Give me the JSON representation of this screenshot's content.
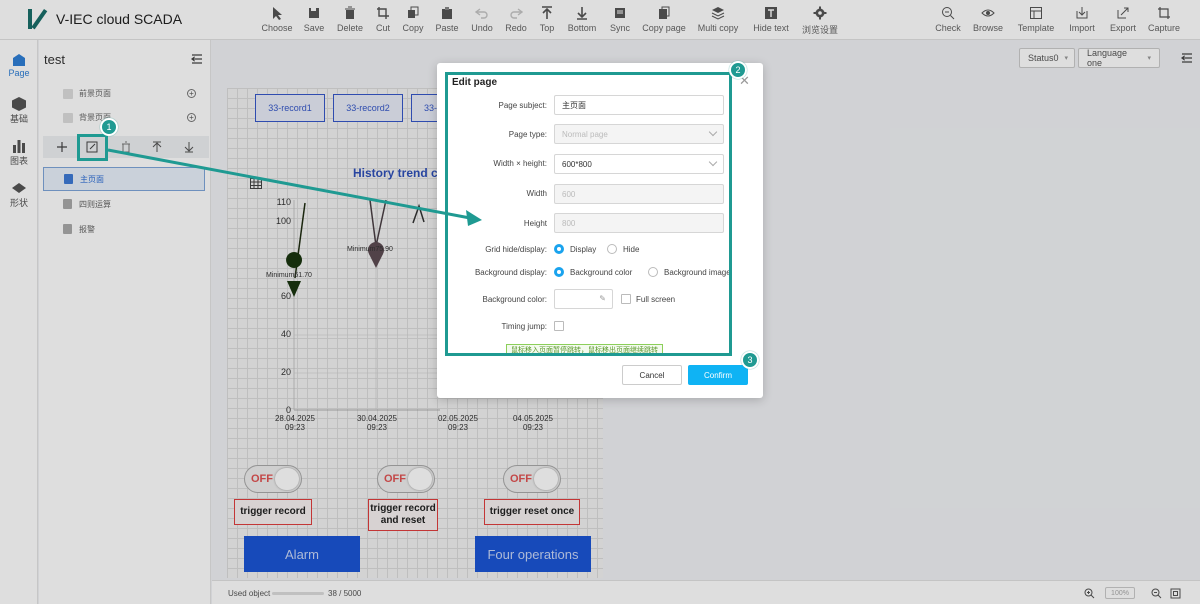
{
  "app": {
    "title": "V-IEC cloud SCADA"
  },
  "toolbar": [
    {
      "label": "Choose",
      "icon": "cursor-icon",
      "x": 253
    },
    {
      "label": "Save",
      "icon": "save-icon",
      "x": 290
    },
    {
      "label": "Delete",
      "icon": "trash-icon",
      "x": 326
    },
    {
      "label": "Cut",
      "icon": "crop-icon",
      "x": 359
    },
    {
      "label": "Copy",
      "icon": "copy-icon",
      "x": 389
    },
    {
      "label": "Paste",
      "icon": "paste-icon",
      "x": 423
    },
    {
      "label": "Undo",
      "icon": "undo-icon",
      "x": 458
    },
    {
      "label": "Redo",
      "icon": "redo-icon",
      "x": 492
    },
    {
      "label": "Top",
      "icon": "bring-top-icon",
      "x": 523
    },
    {
      "label": "Bottom",
      "icon": "send-bottom-icon",
      "x": 558
    },
    {
      "label": "Sync",
      "icon": "sync-icon",
      "x": 596
    },
    {
      "label": "Copy page",
      "icon": "copy-page-icon",
      "x": 640
    },
    {
      "label": "Multi copy",
      "icon": "layers-icon",
      "x": 694
    },
    {
      "label": "Hide text",
      "icon": "text-icon",
      "x": 747
    },
    {
      "label": "浏览设置",
      "icon": "gear-icon",
      "x": 796
    },
    {
      "label": "Check",
      "icon": "zoom-check-icon",
      "x": 924
    },
    {
      "label": "Browse",
      "icon": "eye-icon",
      "x": 964
    },
    {
      "label": "Template",
      "icon": "template-icon",
      "x": 1012
    },
    {
      "label": "Import",
      "icon": "import-icon",
      "x": 1058
    },
    {
      "label": "Export",
      "icon": "export-icon",
      "x": 1099
    },
    {
      "label": "Capture",
      "icon": "capture-icon",
      "x": 1140
    }
  ],
  "rail": [
    {
      "label": "Page",
      "active": true
    },
    {
      "label": "基础",
      "active": false
    },
    {
      "label": "图表",
      "active": false
    },
    {
      "label": "形状",
      "active": false
    }
  ],
  "panel": {
    "title": "test",
    "layers": [
      "前景页面",
      "背景页面"
    ],
    "pages": [
      "主页面",
      "四则运算",
      "报警"
    ]
  },
  "canvas": {
    "records": [
      "33-record1",
      "33-record2",
      "33-"
    ],
    "chart_title": "History trend c",
    "y_ticks": [
      "110",
      "100",
      "60",
      "40",
      "20",
      "0"
    ],
    "x_ticks": [
      [
        "28.04.2025",
        "09:23"
      ],
      [
        "30.04.2025",
        "09:23"
      ],
      [
        "02.05.2025",
        "09:23"
      ],
      [
        "04.05.2025",
        "09:23"
      ]
    ],
    "markers": [
      "Minimum61.70",
      "Minimum75.90"
    ],
    "toggle_text": "OFF",
    "triggers": [
      "trigger record",
      "trigger record and reset",
      "trigger reset once"
    ],
    "buttons": [
      "Alarm",
      "Four operations"
    ]
  },
  "selectors": {
    "status": "Status0",
    "language": "Language one"
  },
  "bottombar": {
    "used_label": "Used object",
    "used_count": "38 / 5000",
    "zoom": "100%"
  },
  "dialog": {
    "title": "Edit page",
    "fields": {
      "page_subject_label": "Page subject:",
      "page_subject_value": "主页面",
      "page_type_label": "Page type:",
      "page_type_value": "Normal page",
      "wh_label": "Width × height:",
      "wh_value": "600*800",
      "width_label": "Width",
      "width_value": "600",
      "height_label": "Height",
      "height_value": "800",
      "grid_label": "Grid hide/display:",
      "grid_display": "Display",
      "grid_hide": "Hide",
      "bg_display_label": "Background display:",
      "bg_color_opt": "Background color",
      "bg_image_opt": "Background image",
      "bg_color_label": "Background color:",
      "full_screen": "Full screen",
      "timing_label": "Timing jump:"
    },
    "hint": "鼠标移入页面暂停跳转，鼠标移出页面继续跳转",
    "cancel": "Cancel",
    "confirm": "Confirm"
  },
  "annotations": [
    "1",
    "2",
    "3"
  ],
  "colors": {
    "accent": "#1f9a92",
    "primary": "#0fb3f4",
    "brand": "#1a6f6a"
  }
}
